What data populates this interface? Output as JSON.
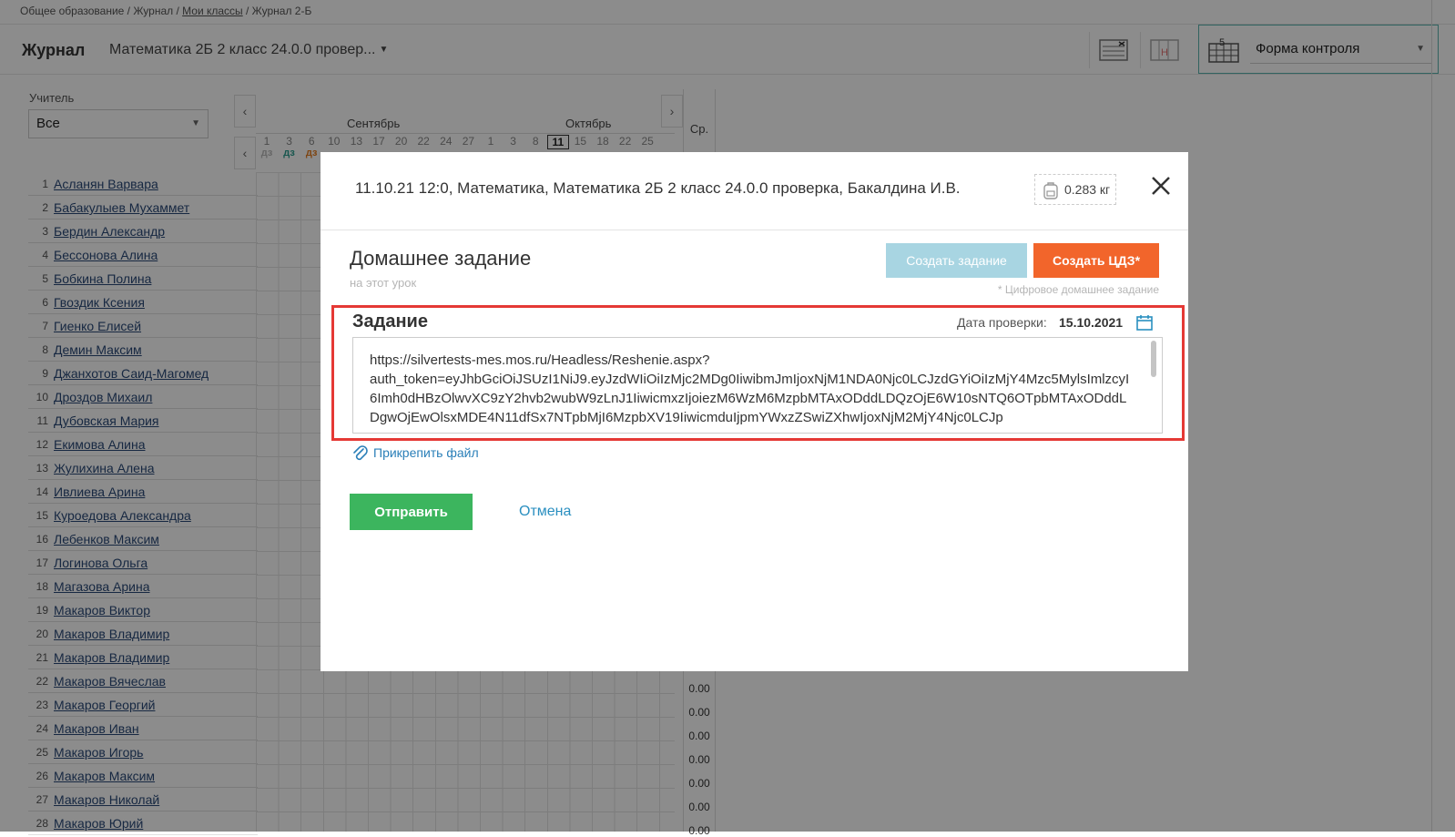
{
  "breadcrumb": {
    "part1": "Общее образование / Журнал / ",
    "link": "Мои классы",
    "part2": " / Журнал 2-Б"
  },
  "topbar": {
    "title": "Журнал",
    "course": "Математика 2Б 2 класс 24.0.0 провер...",
    "form_control": "Форма контроля"
  },
  "filter": {
    "teacher_label": "Учитель",
    "teacher_value": "Все"
  },
  "calendar": {
    "months": [
      "Сентябрь",
      "Октябрь"
    ],
    "days": [
      "1",
      "3",
      "6",
      "10",
      "13",
      "17",
      "20",
      "22",
      "24",
      "27",
      "1",
      "3",
      "8",
      "11",
      "15",
      "18",
      "22",
      "25"
    ],
    "current_day": "11",
    "hw_marks": [
      "дз",
      "дз",
      "дз"
    ],
    "avg_header": "Ср."
  },
  "students": [
    {
      "n": "1",
      "name": "Асланян Варвара"
    },
    {
      "n": "2",
      "name": "Бабакулыев Мухаммет"
    },
    {
      "n": "3",
      "name": "Бердин Александр"
    },
    {
      "n": "4",
      "name": "Бессонова Алина"
    },
    {
      "n": "5",
      "name": "Бобкина Полина"
    },
    {
      "n": "6",
      "name": "Гвоздик Ксения"
    },
    {
      "n": "7",
      "name": "Гиенко Елисей"
    },
    {
      "n": "8",
      "name": "Демин Максим"
    },
    {
      "n": "9",
      "name": "Джанхотов Саид-Магомед"
    },
    {
      "n": "10",
      "name": "Дроздов Михаил"
    },
    {
      "n": "11",
      "name": "Дубовская Мария"
    },
    {
      "n": "12",
      "name": "Екимова Алина"
    },
    {
      "n": "13",
      "name": "Жулихина Алена"
    },
    {
      "n": "14",
      "name": "Ивлиева Арина"
    },
    {
      "n": "15",
      "name": "Куроедова Александра"
    },
    {
      "n": "16",
      "name": "Лебенков Максим"
    },
    {
      "n": "17",
      "name": "Логинова Ольга"
    },
    {
      "n": "18",
      "name": "Магазова Арина"
    },
    {
      "n": "19",
      "name": "Макаров Виктор"
    },
    {
      "n": "20",
      "name": "Макаров Владимир"
    },
    {
      "n": "21",
      "name": "Макаров Владимир"
    },
    {
      "n": "22",
      "name": "Макаров Вячеслав"
    },
    {
      "n": "23",
      "name": "Макаров Георгий"
    },
    {
      "n": "24",
      "name": "Макаров Иван"
    },
    {
      "n": "25",
      "name": "Макаров Игорь"
    },
    {
      "n": "26",
      "name": "Макаров Максим"
    },
    {
      "n": "27",
      "name": "Макаров Николай"
    },
    {
      "n": "28",
      "name": "Макаров Юрий"
    }
  ],
  "averages": [
    "0.00",
    "0.00",
    "0.00",
    "0.00",
    "0.00",
    "0.00",
    "0.00"
  ],
  "modal": {
    "lesson_title": "11.10.21 12:0, Математика, Математика 2Б 2 класс 24.0.0 проверка, Бакалдина И.В.",
    "weight": "0.283 кг",
    "hw_title": "Домашнее задание",
    "hw_subtitle": "на этот урок",
    "create_task_label": "Создать задание",
    "create_cdz_label": "Создать ЦДЗ*",
    "cdz_note": "* Цифровое домашнее задание",
    "task_label": "Задание",
    "due_label": "Дата проверки:",
    "due_value": "15.10.2021",
    "task_text": "https://silvertests-mes.mos.ru/Headless/Reshenie.aspx?\nauth_token=eyJhbGciOiJSUzI1NiJ9.eyJzdWIiOiIzMjc2MDg0IiwibmJmIjoxNjM1NDA0Njc0LCJzdGYiOiIzMjY4Mzc5MylsImlzcyI6Imh0dHBzOlwvXC9zY2hvb2wubW9zLnJ1IiwicmxzIjoiezM6WzM6MzpbMTAxODddLDQzOjE6W10sNTQ6OTpbMTAxODddLDgwOjEwOlsxMDE4N11dfSx7NTpbMjI6MzpbXV19IiwicmduIjpmYWxzZSwiZXhwIjoxNjM2MjY4Njc0LCJp",
    "attach_label": "Прикрепить файл",
    "send_label": "Отправить",
    "cancel_label": "Отмена"
  },
  "colors": {
    "accent_orange": "#f2652b",
    "send_green": "#3cb55e",
    "highlight_red": "#e53935",
    "link_blue": "#2a7fb8"
  }
}
